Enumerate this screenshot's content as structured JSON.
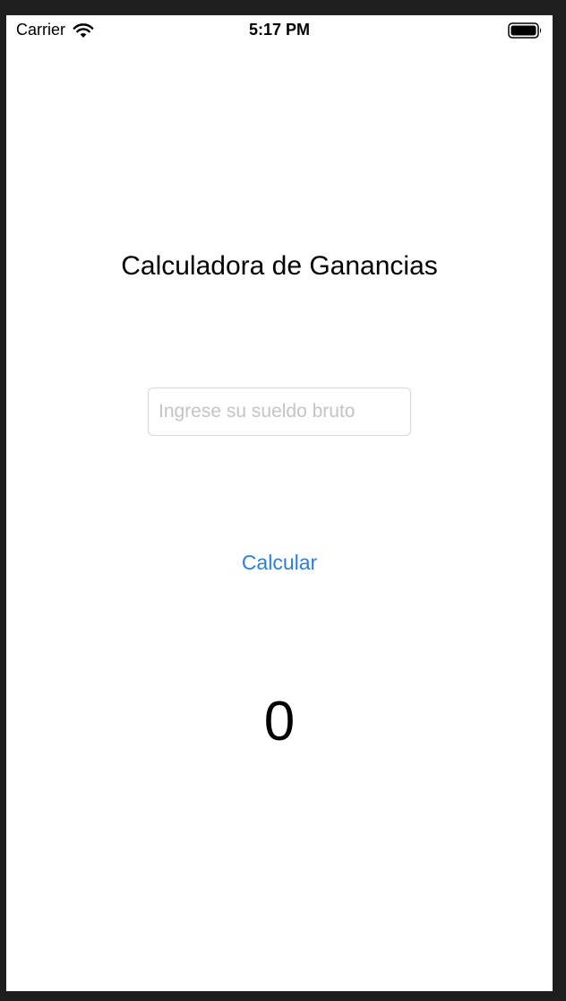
{
  "status_bar": {
    "carrier": "Carrier",
    "time": "5:17 PM",
    "wifi_icon": "wifi-icon",
    "battery_icon": "battery-icon"
  },
  "screen": {
    "title": "Calculadora de Ganancias",
    "salary_input": {
      "value": "",
      "placeholder": "Ingrese su sueldo bruto"
    },
    "calculate_button_label": "Calcular",
    "result": "0"
  },
  "colors": {
    "accent": "#2f7de1",
    "background": "#ffffff",
    "frame": "#1e1e1e"
  }
}
